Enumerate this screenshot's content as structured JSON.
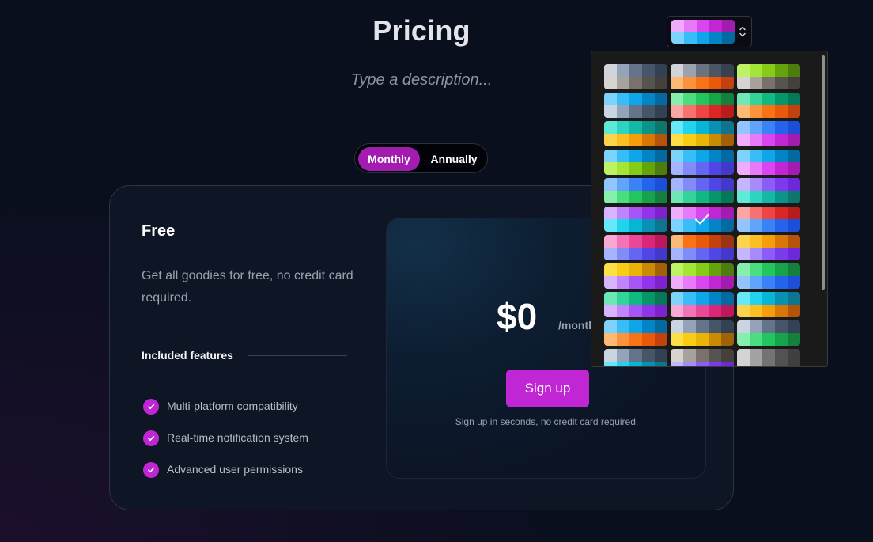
{
  "page": {
    "title": "Pricing",
    "description": "Type a description..."
  },
  "billing_toggle": {
    "monthly": "Monthly",
    "annually": "Annually"
  },
  "plan": {
    "name": "Free",
    "description": "Get all goodies for free, no credit card required.",
    "features_heading": "Included features",
    "features": [
      "Multi-platform compatibility",
      "Real-time notification system",
      "Advanced user permissions"
    ],
    "price": "$0",
    "period": "/month",
    "cta": "Sign up",
    "note": "Sign up in seconds, no credit card required."
  },
  "icons": {
    "feature": "check-icon",
    "selector": "chevron-up-down-icon",
    "selected": "checkmark-icon"
  },
  "colors": {
    "accent": "#c026d3",
    "toggle_active": "#a21caf",
    "background": "#0a0f1e"
  },
  "palette_picker": {
    "selected_index": 16,
    "palettes": [
      [
        [
          "#d1d5db",
          "#94a3b8",
          "#64748b",
          "#475569",
          "#334155"
        ],
        [
          "#d6d3d1",
          "#a8a29e",
          "#78716c",
          "#57534e",
          "#44403c"
        ]
      ],
      [
        [
          "#d1d5db",
          "#9ca3af",
          "#6b7280",
          "#4b5563",
          "#374151"
        ],
        [
          "#fdba74",
          "#fb923c",
          "#f97316",
          "#ea580c",
          "#c2410c"
        ]
      ],
      [
        [
          "#bef264",
          "#a3e635",
          "#84cc16",
          "#65a30d",
          "#4d7c0f"
        ],
        [
          "#d6d3d1",
          "#a8a29e",
          "#78716c",
          "#57534e",
          "#44403c"
        ]
      ],
      [
        [
          "#7dd3fc",
          "#38bdf8",
          "#0ea5e9",
          "#0284c7",
          "#0369a1"
        ],
        [
          "#cbd5e1",
          "#94a3b8",
          "#64748b",
          "#475569",
          "#334155"
        ]
      ],
      [
        [
          "#86efac",
          "#4ade80",
          "#22c55e",
          "#16a34a",
          "#15803d"
        ],
        [
          "#fca5a5",
          "#f87171",
          "#ef4444",
          "#dc2626",
          "#b91c1c"
        ]
      ],
      [
        [
          "#6ee7b7",
          "#34d399",
          "#10b981",
          "#059669",
          "#047857"
        ],
        [
          "#fdba74",
          "#fb923c",
          "#f97316",
          "#ea580c",
          "#c2410c"
        ]
      ],
      [
        [
          "#5eead4",
          "#2dd4bf",
          "#14b8a6",
          "#0d9488",
          "#0f766e"
        ],
        [
          "#fcd34d",
          "#fbbf24",
          "#f59e0b",
          "#d97706",
          "#b45309"
        ]
      ],
      [
        [
          "#67e8f9",
          "#22d3ee",
          "#06b6d4",
          "#0891b2",
          "#0e7490"
        ],
        [
          "#fde047",
          "#facc15",
          "#eab308",
          "#ca8a04",
          "#a16207"
        ]
      ],
      [
        [
          "#93c5fd",
          "#60a5fa",
          "#3b82f6",
          "#2563eb",
          "#1d4ed8"
        ],
        [
          "#f0abfc",
          "#e879f9",
          "#d946ef",
          "#c026d3",
          "#a21caf"
        ]
      ],
      [
        [
          "#7dd3fc",
          "#38bdf8",
          "#0ea5e9",
          "#0284c7",
          "#0369a1"
        ],
        [
          "#bef264",
          "#a3e635",
          "#84cc16",
          "#65a30d",
          "#4d7c0f"
        ]
      ],
      [
        [
          "#7dd3fc",
          "#38bdf8",
          "#0ea5e9",
          "#0284c7",
          "#0369a1"
        ],
        [
          "#a5b4fc",
          "#818cf8",
          "#6366f1",
          "#4f46e5",
          "#4338ca"
        ]
      ],
      [
        [
          "#7dd3fc",
          "#38bdf8",
          "#0ea5e9",
          "#0284c7",
          "#0369a1"
        ],
        [
          "#f0abfc",
          "#e879f9",
          "#d946ef",
          "#c026d3",
          "#a21caf"
        ]
      ],
      [
        [
          "#93c5fd",
          "#60a5fa",
          "#3b82f6",
          "#2563eb",
          "#1d4ed8"
        ],
        [
          "#86efac",
          "#4ade80",
          "#22c55e",
          "#16a34a",
          "#15803d"
        ]
      ],
      [
        [
          "#a5b4fc",
          "#818cf8",
          "#6366f1",
          "#4f46e5",
          "#4338ca"
        ],
        [
          "#6ee7b7",
          "#34d399",
          "#10b981",
          "#059669",
          "#047857"
        ]
      ],
      [
        [
          "#c4b5fd",
          "#a78bfa",
          "#8b5cf6",
          "#7c3aed",
          "#6d28d9"
        ],
        [
          "#5eead4",
          "#2dd4bf",
          "#14b8a6",
          "#0d9488",
          "#0f766e"
        ]
      ],
      [
        [
          "#d8b4fe",
          "#c084fc",
          "#a855f7",
          "#9333ea",
          "#7e22ce"
        ],
        [
          "#67e8f9",
          "#22d3ee",
          "#06b6d4",
          "#0891b2",
          "#0e7490"
        ]
      ],
      [
        [
          "#f0abfc",
          "#e879f9",
          "#d946ef",
          "#c026d3",
          "#a21caf"
        ],
        [
          "#7dd3fc",
          "#38bdf8",
          "#0ea5e9",
          "#0284c7",
          "#0369a1"
        ]
      ],
      [
        [
          "#fca5a5",
          "#f87171",
          "#ef4444",
          "#dc2626",
          "#b91c1c"
        ],
        [
          "#93c5fd",
          "#60a5fa",
          "#3b82f6",
          "#2563eb",
          "#1d4ed8"
        ]
      ],
      [
        [
          "#f9a8d4",
          "#f472b6",
          "#ec4899",
          "#db2777",
          "#be185d"
        ],
        [
          "#a5b4fc",
          "#818cf8",
          "#6366f1",
          "#4f46e5",
          "#4338ca"
        ]
      ],
      [
        [
          "#fdba74",
          "#f97316",
          "#ea580c",
          "#c2410c",
          "#9a3412"
        ],
        [
          "#a5b4fc",
          "#818cf8",
          "#6366f1",
          "#4f46e5",
          "#4338ca"
        ]
      ],
      [
        [
          "#fcd34d",
          "#fbbf24",
          "#f59e0b",
          "#d97706",
          "#b45309"
        ],
        [
          "#c4b5fd",
          "#a78bfa",
          "#8b5cf6",
          "#7c3aed",
          "#6d28d9"
        ]
      ],
      [
        [
          "#fde047",
          "#facc15",
          "#eab308",
          "#ca8a04",
          "#a16207"
        ],
        [
          "#d8b4fe",
          "#c084fc",
          "#a855f7",
          "#9333ea",
          "#7e22ce"
        ]
      ],
      [
        [
          "#bef264",
          "#a3e635",
          "#84cc16",
          "#65a30d",
          "#4d7c0f"
        ],
        [
          "#f0abfc",
          "#e879f9",
          "#d946ef",
          "#c026d3",
          "#a21caf"
        ]
      ],
      [
        [
          "#86efac",
          "#4ade80",
          "#22c55e",
          "#16a34a",
          "#15803d"
        ],
        [
          "#93c5fd",
          "#60a5fa",
          "#3b82f6",
          "#2563eb",
          "#1d4ed8"
        ]
      ],
      [
        [
          "#6ee7b7",
          "#34d399",
          "#10b981",
          "#059669",
          "#047857"
        ],
        [
          "#d8b4fe",
          "#c084fc",
          "#a855f7",
          "#9333ea",
          "#7e22ce"
        ]
      ],
      [
        [
          "#7dd3fc",
          "#38bdf8",
          "#0ea5e9",
          "#0284c7",
          "#0369a1"
        ],
        [
          "#f9a8d4",
          "#f472b6",
          "#ec4899",
          "#db2777",
          "#be185d"
        ]
      ],
      [
        [
          "#67e8f9",
          "#22d3ee",
          "#06b6d4",
          "#0891b2",
          "#0e7490"
        ],
        [
          "#fcd34d",
          "#fbbf24",
          "#f59e0b",
          "#d97706",
          "#b45309"
        ]
      ],
      [
        [
          "#7dd3fc",
          "#38bdf8",
          "#0ea5e9",
          "#0284c7",
          "#0369a1"
        ],
        [
          "#fdba74",
          "#fb923c",
          "#f97316",
          "#ea580c",
          "#c2410c"
        ]
      ],
      [
        [
          "#cbd5e1",
          "#94a3b8",
          "#64748b",
          "#475569",
          "#334155"
        ],
        [
          "#fde047",
          "#facc15",
          "#eab308",
          "#ca8a04",
          "#a16207"
        ]
      ],
      [
        [
          "#cbd5e1",
          "#94a3b8",
          "#64748b",
          "#475569",
          "#334155"
        ],
        [
          "#86efac",
          "#4ade80",
          "#22c55e",
          "#16a34a",
          "#15803d"
        ]
      ],
      [
        [
          "#cbd5e1",
          "#94a3b8",
          "#64748b",
          "#475569",
          "#334155"
        ],
        [
          "#67e8f9",
          "#22d3ee",
          "#06b6d4",
          "#0891b2",
          "#0e7490"
        ]
      ],
      [
        [
          "#d6d3d1",
          "#a8a29e",
          "#78716c",
          "#57534e",
          "#44403c"
        ],
        [
          "#c4b5fd",
          "#a78bfa",
          "#8b5cf6",
          "#7c3aed",
          "#6d28d9"
        ]
      ],
      [
        [
          "#d4d4d4",
          "#a3a3a3",
          "#737373",
          "#525252",
          "#404040"
        ],
        [
          "#d4d4d4",
          "#a3a3a3",
          "#737373",
          "#525252",
          "#404040"
        ]
      ]
    ]
  }
}
